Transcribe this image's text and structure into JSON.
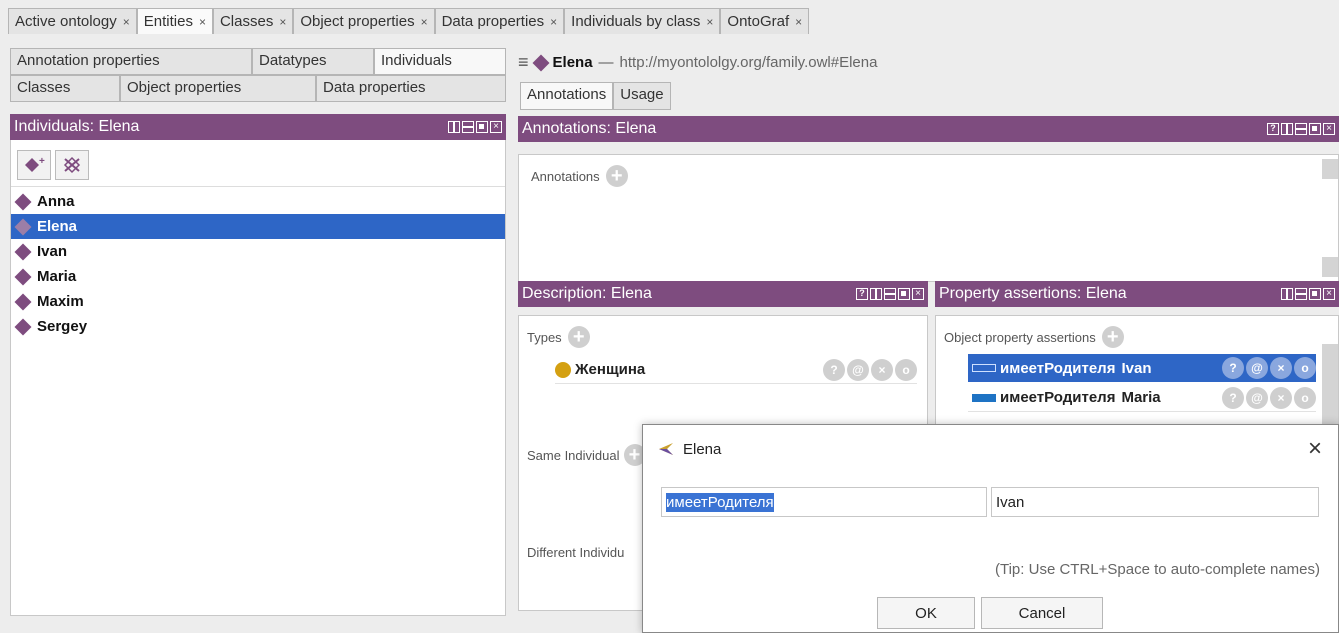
{
  "top_tabs": [
    {
      "label": "Active ontology",
      "close": "×"
    },
    {
      "label": "Entities",
      "close": "×"
    },
    {
      "label": "Classes",
      "close": "×"
    },
    {
      "label": "Object properties",
      "close": "×"
    },
    {
      "label": "Data properties",
      "close": "×"
    },
    {
      "label": "Individuals by class",
      "close": "×"
    },
    {
      "label": "OntoGraf",
      "close": "×"
    }
  ],
  "sub_tabs_row1": [
    "Annotation properties",
    "Datatypes",
    "Individuals"
  ],
  "sub_tabs_row2": [
    "Classes",
    "Object properties",
    "Data properties"
  ],
  "individuals_panel": {
    "title": "Individuals: Elena",
    "items": [
      "Anna",
      "Elena",
      "Ivan",
      "Maria",
      "Maxim",
      "Sergey"
    ],
    "selected": "Elena"
  },
  "entity_header": {
    "name": "Elena",
    "separator": "—",
    "iri": "http://myontololgy.org/family.owl#Elena"
  },
  "right_tabs": [
    "Annotations",
    "Usage"
  ],
  "annotations_panel": {
    "title": "Annotations: Elena",
    "label": "Annotations"
  },
  "description_panel": {
    "title": "Description: Elena",
    "types_label": "Types",
    "type_item": "Женщина",
    "same_label": "Same Individual",
    "different_label": "Different Individu"
  },
  "property_panel": {
    "title": "Property assertions: Elena",
    "section_label": "Object property assertions",
    "assertions": [
      {
        "property": "имеетРодителя",
        "value": "Ivan"
      },
      {
        "property": "имеетРодителя",
        "value": "Maria"
      }
    ]
  },
  "dialog": {
    "title": "Elena",
    "close": "×",
    "property_value": "имеетРодителя",
    "individual_value": "Ivan",
    "tip": "(Tip: Use CTRL+Space to auto-complete names)",
    "ok": "OK",
    "cancel": "Cancel"
  },
  "colors": {
    "header_purple": "#7e4c7f",
    "selection_blue": "#2e66c6",
    "class_dot": "#d4a012"
  }
}
